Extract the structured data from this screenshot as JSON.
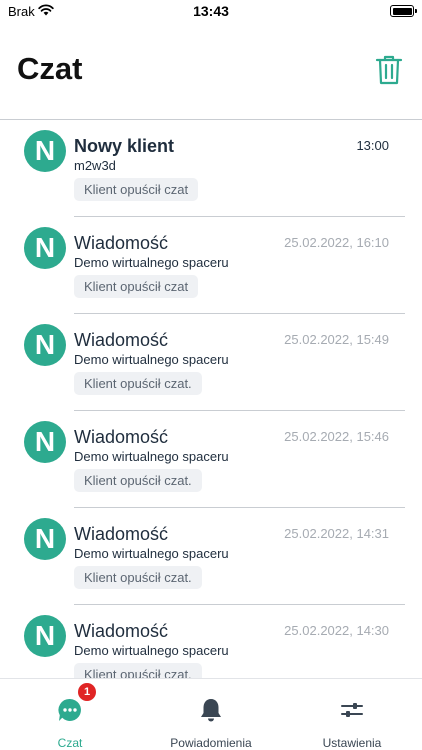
{
  "status_bar": {
    "carrier": "Brak",
    "time": "13:43"
  },
  "header": {
    "title": "Czat"
  },
  "colors": {
    "accent": "#2daa8f",
    "badge": "#e02424"
  },
  "chats": [
    {
      "avatar": "N",
      "name": "Nowy klient",
      "subtitle": "m2w3d",
      "time": "13:00",
      "status": "Klient opuścił czat",
      "unread": true
    },
    {
      "avatar": "N",
      "name": "Wiadomość",
      "subtitle": "Demo wirtualnego spaceru",
      "time": "25.02.2022, 16:10",
      "status": "Klient opuścił czat",
      "unread": false
    },
    {
      "avatar": "N",
      "name": "Wiadomość",
      "subtitle": "Demo wirtualnego spaceru",
      "time": "25.02.2022, 15:49",
      "status": "Klient opuścił czat.",
      "unread": false
    },
    {
      "avatar": "N",
      "name": "Wiadomość",
      "subtitle": "Demo wirtualnego spaceru",
      "time": "25.02.2022, 15:46",
      "status": "Klient opuścił czat.",
      "unread": false
    },
    {
      "avatar": "N",
      "name": "Wiadomość",
      "subtitle": "Demo wirtualnego spaceru",
      "time": "25.02.2022, 14:31",
      "status": "Klient opuścił czat.",
      "unread": false
    },
    {
      "avatar": "N",
      "name": "Wiadomość",
      "subtitle": "Demo wirtualnego spaceru",
      "time": "25.02.2022, 14:30",
      "status": "Klient opuścił czat.",
      "unread": false
    }
  ],
  "tabs": [
    {
      "label": "Czat",
      "icon": "chat-bubble-icon",
      "badge": "1",
      "active": true
    },
    {
      "label": "Powiadomienia",
      "icon": "bell-icon",
      "active": false
    },
    {
      "label": "Ustawienia",
      "icon": "sliders-icon",
      "active": false
    }
  ]
}
